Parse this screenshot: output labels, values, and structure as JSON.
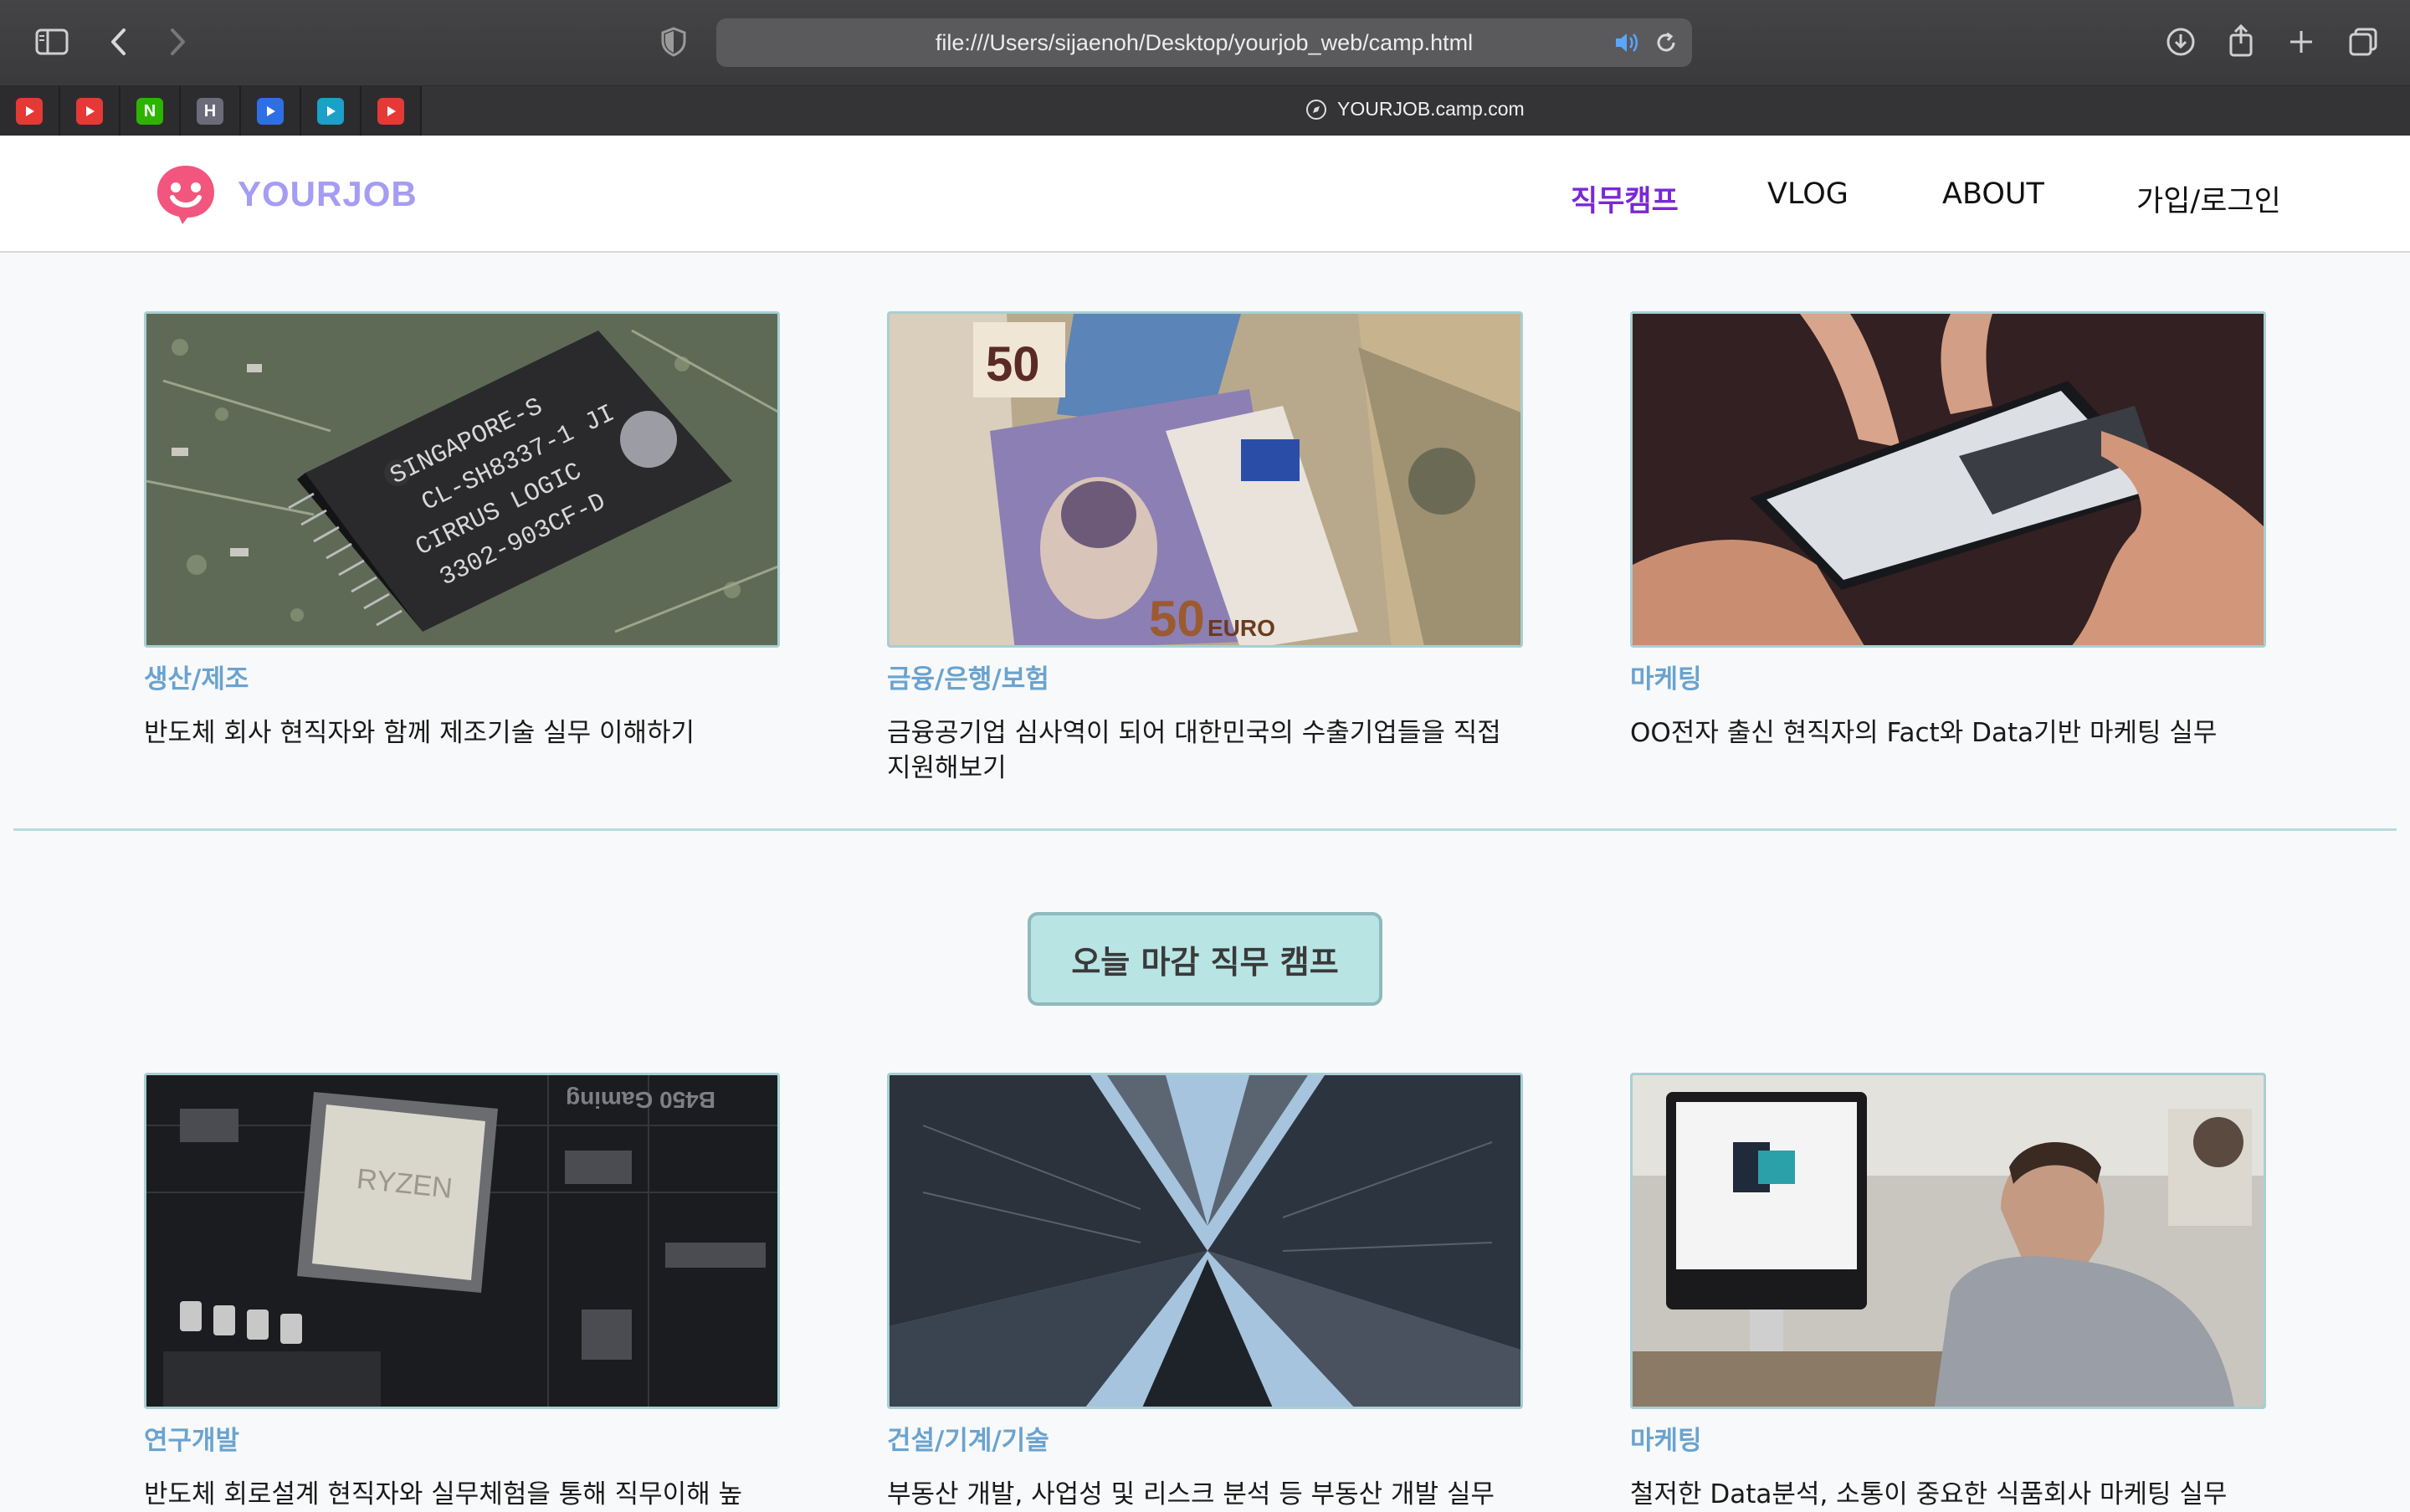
{
  "browser": {
    "url": "file:///Users/sijaenoh/Desktop/yourjob_web/camp.html",
    "tab_title": "YOURJOB.camp.com",
    "favorites": [
      {
        "name": "youtube-music",
        "letter": "",
        "color": "#e53935"
      },
      {
        "name": "youtube",
        "letter": "",
        "color": "#e53935"
      },
      {
        "name": "naver",
        "letter": "N",
        "color": "#2db400"
      },
      {
        "name": "h-site",
        "letter": "H",
        "color": "#6b6b7a"
      },
      {
        "name": "mail",
        "letter": "",
        "color": "#2e6fe6"
      },
      {
        "name": "edge",
        "letter": "",
        "color": "#1aa0c9"
      },
      {
        "name": "youtube-2",
        "letter": "",
        "color": "#e53935"
      }
    ]
  },
  "site": {
    "logo_text": "YOURJOB",
    "nav": [
      {
        "label": "직무캠프",
        "active": true
      },
      {
        "label": "VLOG",
        "active": false
      },
      {
        "label": "ABOUT",
        "active": false
      },
      {
        "label": "가입/로그인",
        "active": false
      }
    ]
  },
  "sections": {
    "top_cards": [
      {
        "category": "생산/제조",
        "title": "반도체 회사 현직자와 함께 제조기술 실무 이해하기",
        "image": "circuit-chip-photo"
      },
      {
        "category": "금융/은행/보험",
        "title": "금융공기업 심사역이 되어 대한민국의 수출기업들을 직접 지원해보기",
        "image": "banknotes-photo"
      },
      {
        "category": "마케팅",
        "title": "OO전자 출신 현직자의 Fact와 Data기반 마케팅 실무",
        "image": "smartphone-hands-photo"
      }
    ],
    "today_button_label": "오늘 마감 직무 캠프",
    "bottom_cards": [
      {
        "category": "연구개발",
        "title": "반도체 회로설계 현직자와 실무체험을 통해 직무이해 높",
        "image": "ryzen-motherboard-photo"
      },
      {
        "category": "건설/기계/기술",
        "title": "부동산 개발, 사업성 및 리스크 분석 등 부동산 개발 실무",
        "image": "skyscrapers-photo"
      },
      {
        "category": "마케팅",
        "title": "철저한 Data분석, 소통이 중요한 식품회사 마케팅 실무",
        "image": "office-computer-photo"
      }
    ]
  },
  "colors": {
    "nav_active": "#7a28d6",
    "category": "#6aa3cf",
    "logo": "#a59cf4",
    "logo_icon": "#f2557d",
    "button_bg": "#b9e4e4",
    "accent_line": "#b9dcdf"
  }
}
